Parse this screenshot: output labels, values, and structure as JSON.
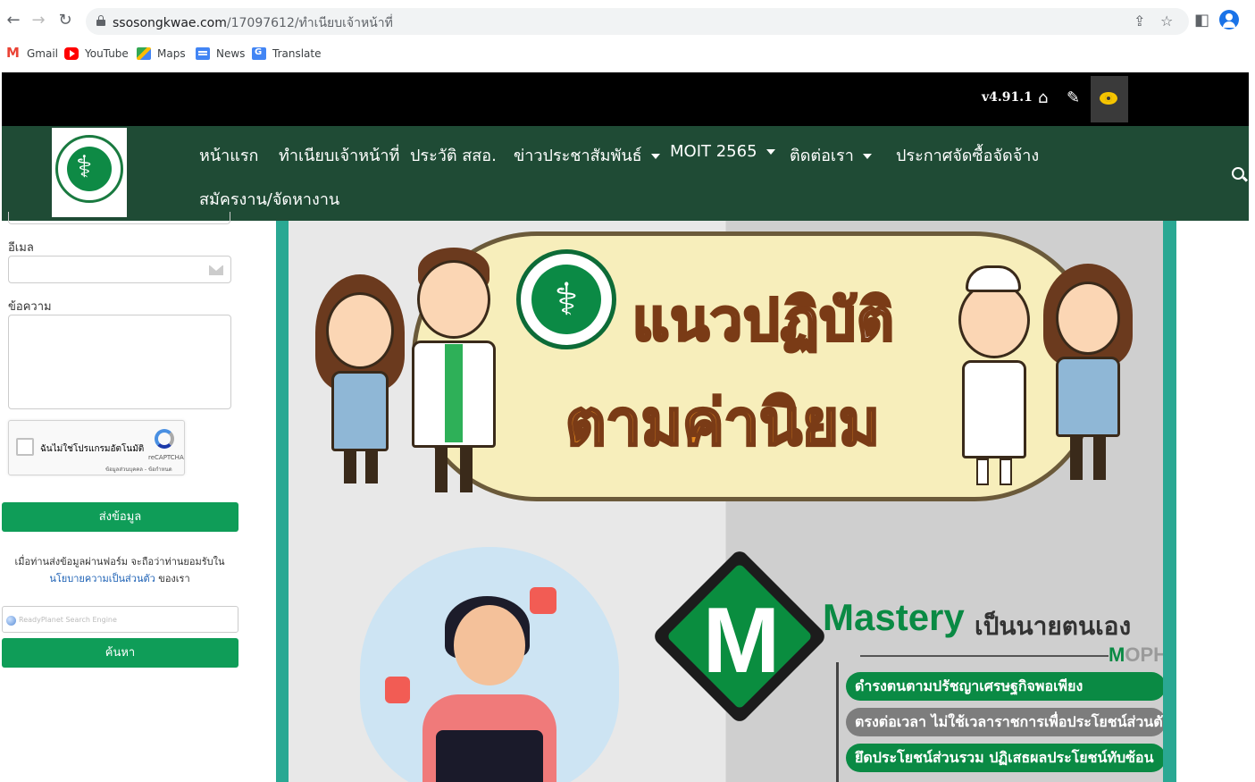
{
  "browser": {
    "url_host": "ssosongkwae.com",
    "url_path": "/17097612/ทำเนียบเจ้าหน้าที่",
    "bookmarks": [
      {
        "label": "Gmail",
        "icon": "gmail-icon"
      },
      {
        "label": "YouTube",
        "icon": "youtube-icon"
      },
      {
        "label": "Maps",
        "icon": "maps-icon"
      },
      {
        "label": "News",
        "icon": "news-icon"
      },
      {
        "label": "Translate",
        "icon": "translate-icon"
      }
    ]
  },
  "topbar": {
    "version": "v4.91.1",
    "icons": [
      "home-icon",
      "pencil-icon",
      "eye-icon"
    ]
  },
  "nav": {
    "items": [
      {
        "label": "หน้าแรก",
        "dropdown": false
      },
      {
        "label": "ทำเนียบเจ้าหน้าที่",
        "dropdown": false
      },
      {
        "label": "ประวัติ สสอ.",
        "dropdown": false
      },
      {
        "label": "ข่าวประชาสัมพันธ์",
        "dropdown": true
      },
      {
        "label": "MOIT 2565",
        "dropdown": true
      },
      {
        "label": "ติดต่อเรา",
        "dropdown": true
      },
      {
        "label": "ประกาศจัดซื้อจัดจ้าง",
        "dropdown": false
      },
      {
        "label": "สมัครงาน/จัดหางาน",
        "dropdown": false
      }
    ]
  },
  "form": {
    "email_label": "อีเมล",
    "message_label": "ข้อความ",
    "captcha_text": "ฉันไม่ใช่โปรแกรมอัตโนมัติ",
    "captcha_brand": "reCAPTCHA",
    "captcha_links": "ข้อมูลส่วนบุคคล - ข้อกำหนด",
    "submit_label": "ส่งข้อมูล",
    "note_line1": "เมื่อท่านส่งข้อมูลผ่านฟอร์ม จะถือว่าท่านยอมรับใน",
    "note_link": "นโยบายความเป็นส่วนตัว",
    "note_suffix": " ของเรา",
    "search_placeholder": "ReadyPlanet Search Engine",
    "search_button": "ค้นหา"
  },
  "banner": {
    "title_line1": "แนวปฏิบัติ",
    "title_line2": "ตามค่านิยม",
    "mastery": "Mastery",
    "mastery_thai": "เป็นนายตนเอง",
    "moph_m": "M",
    "moph_rest": "OPH",
    "m_letter": "M",
    "slogans": [
      "ดำรงตนตามปรัชญาเศรษฐกิจพอเพียง",
      "ตรงต่อเวลา ไม่ใช้เวลาราชการเพื่อประโยชน์ส่วนตัว",
      "ยึดประโยชน์ส่วนรวม ปฏิเสธผลประโยชน์ทับซ้อน"
    ]
  },
  "colors": {
    "nav_bg": "#1f4b35",
    "topbar_bg": "#000000",
    "button_green": "#0f9d58",
    "banner_frame": "#2aa893"
  }
}
